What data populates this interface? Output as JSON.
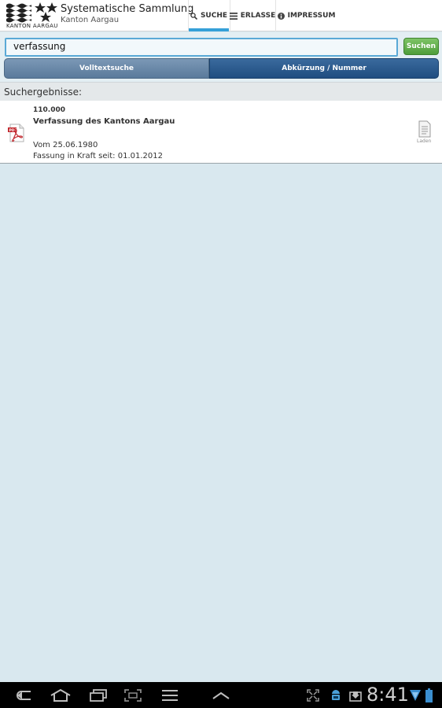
{
  "header": {
    "logo_caption": "KANTON AARGAU",
    "title": "Systematische Sammlung",
    "subtitle": "Kanton Aargau"
  },
  "tabs": [
    {
      "label": "SUCHE",
      "icon": "search-icon",
      "active": true
    },
    {
      "label": "ERLASSE",
      "icon": "list-icon",
      "active": false
    },
    {
      "label": "IMPRESSUM",
      "icon": "info-icon",
      "active": false
    }
  ],
  "search": {
    "value": "verfassung",
    "button_label": "Suchen"
  },
  "segments": {
    "fulltext_label": "Volltextsuche",
    "abbr_label": "Abkürzung / Nummer",
    "selected": "Abkürzung / Nummer"
  },
  "results": {
    "heading": "Suchergebnisse:",
    "items": [
      {
        "number": "110.000",
        "title": "Verfassung des Kantons Aargau",
        "date": "Vom 25.06.1980",
        "in_force": "Fassung in Kraft seit: 01.01.2012",
        "icon": "pdf-icon",
        "action_label": "Laden"
      }
    ]
  },
  "system_bar": {
    "time": "8:41",
    "icons": [
      "back-icon",
      "home-icon",
      "recent-apps-icon",
      "screenshot-icon",
      "menu-icon",
      "chevron-up-icon",
      "fullscreen-icon",
      "android-icon",
      "download-icon",
      "wifi-icon",
      "battery-icon"
    ]
  },
  "colors": {
    "accent": "#35a0d8",
    "search_button": "#5aa845",
    "segment_selected": "#2b5b8e",
    "background": "#d9e8ef"
  }
}
